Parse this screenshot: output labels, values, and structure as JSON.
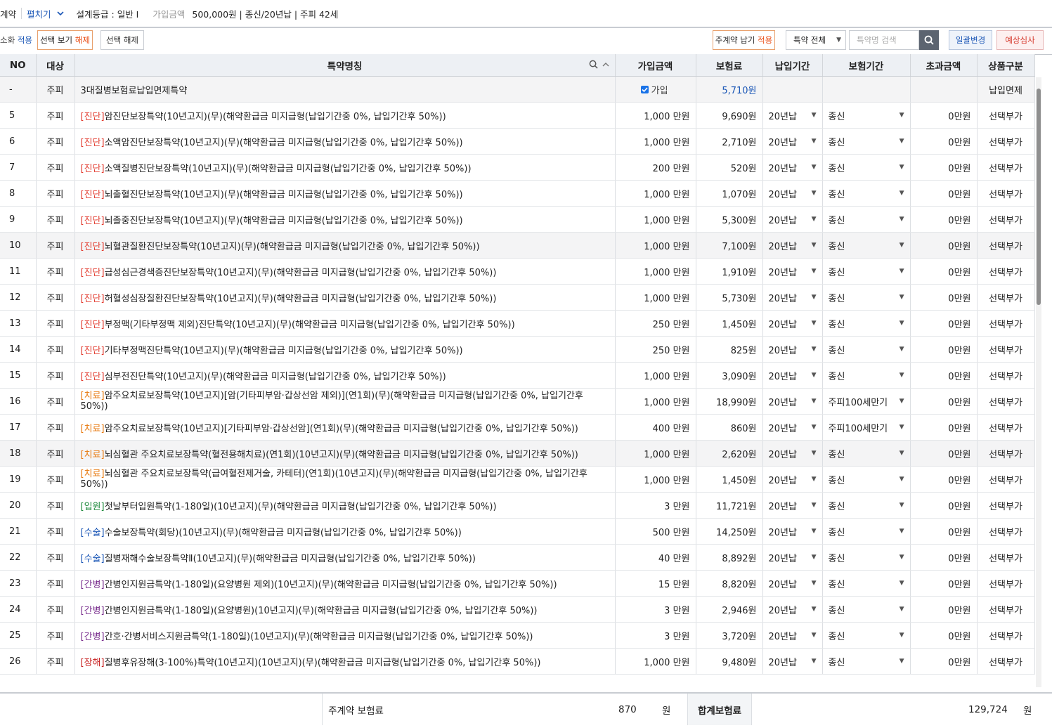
{
  "topbar": {
    "title_fragment": "계약",
    "expand_label": "펼치기",
    "grade": "설계등급 : 일반 I",
    "amount_label": "가입금액",
    "amount_value": "500,000원 | 종신/20년납 | 주피 42세"
  },
  "toolbar": {
    "apply_left_a": "소화",
    "apply_left_b": "적용",
    "view_selected_a": "선택 보기",
    "view_selected_b": "해제",
    "clear_selection": "선택 해제",
    "main_pay_a": "주계약 납기",
    "main_pay_b": "적용",
    "filter_value": "특약 전체",
    "search_placeholder": "특약명 검색",
    "bulk_change": "일괄변경",
    "review": "예상심사"
  },
  "columns": [
    "NO",
    "대상",
    "특약명칭",
    "가입금액",
    "보험료",
    "납입기간",
    "보험기간",
    "초과금액",
    "상품구분"
  ],
  "waiver_row": {
    "no": "-",
    "target": "주피",
    "name": "3대질병보험료납입면제특약",
    "checkbox_label": "가입",
    "premium": "5,710원",
    "kind": "납입면제"
  },
  "rows": [
    {
      "no": "5",
      "target": "주피",
      "tag": "[진단]",
      "tagcls": "진단",
      "name": "암진단보장특약(10년고지)(무)(해약환급금 미지급형(납입기간중 0%, 납입기간후 50%))",
      "amount": "1,000 만원",
      "premium": "9,690원",
      "pay": "20년납",
      "term": "종신",
      "excess": "0만원",
      "kind": "선택부가"
    },
    {
      "no": "6",
      "target": "주피",
      "tag": "[진단]",
      "tagcls": "진단",
      "name": "소액암진단보장특약(10년고지)(무)(해약환급금 미지급형(납입기간중 0%, 납입기간후 50%))",
      "amount": "1,000 만원",
      "premium": "2,710원",
      "pay": "20년납",
      "term": "종신",
      "excess": "0만원",
      "kind": "선택부가"
    },
    {
      "no": "7",
      "target": "주피",
      "tag": "[진단]",
      "tagcls": "진단",
      "name": "소액질병진단보장특약(10년고지)(무)(해약환급금 미지급형(납입기간중 0%, 납입기간후 50%))",
      "amount": "200 만원",
      "premium": "520원",
      "pay": "20년납",
      "term": "종신",
      "excess": "0만원",
      "kind": "선택부가"
    },
    {
      "no": "8",
      "target": "주피",
      "tag": "[진단]",
      "tagcls": "진단",
      "name": "뇌출혈진단보장특약(10년고지)(무)(해약환급금 미지급형(납입기간중 0%, 납입기간후 50%))",
      "amount": "1,000 만원",
      "premium": "1,070원",
      "pay": "20년납",
      "term": "종신",
      "excess": "0만원",
      "kind": "선택부가"
    },
    {
      "no": "9",
      "target": "주피",
      "tag": "[진단]",
      "tagcls": "진단",
      "name": "뇌졸중진단보장특약(10년고지)(무)(해약환급금 미지급형(납입기간중 0%, 납입기간후 50%))",
      "amount": "1,000 만원",
      "premium": "5,300원",
      "pay": "20년납",
      "term": "종신",
      "excess": "0만원",
      "kind": "선택부가"
    },
    {
      "no": "10",
      "target": "주피",
      "tag": "[진단]",
      "tagcls": "진단",
      "name": "뇌혈관질환진단보장특약(10년고지)(무)(해약환급금 미지급형(납입기간중 0%, 납입기간후 50%))",
      "amount": "1,000 만원",
      "premium": "7,100원",
      "pay": "20년납",
      "term": "종신",
      "excess": "0만원",
      "kind": "선택부가",
      "alt": true
    },
    {
      "no": "11",
      "target": "주피",
      "tag": "[진단]",
      "tagcls": "진단",
      "name": "급성심근경색증진단보장특약(10년고지)(무)(해약환급금 미지급형(납입기간중 0%, 납입기간후 50%))",
      "amount": "1,000 만원",
      "premium": "1,910원",
      "pay": "20년납",
      "term": "종신",
      "excess": "0만원",
      "kind": "선택부가"
    },
    {
      "no": "12",
      "target": "주피",
      "tag": "[진단]",
      "tagcls": "진단",
      "name": "허혈성심장질환진단보장특약(10년고지)(무)(해약환급금 미지급형(납입기간중 0%, 납입기간후 50%))",
      "amount": "1,000 만원",
      "premium": "5,730원",
      "pay": "20년납",
      "term": "종신",
      "excess": "0만원",
      "kind": "선택부가"
    },
    {
      "no": "13",
      "target": "주피",
      "tag": "[진단]",
      "tagcls": "진단",
      "name": "부정맥(기타부정맥 제외)진단특약(10년고지)(무)(해약환급금 미지급형(납입기간중 0%, 납입기간후 50%))",
      "amount": "250 만원",
      "premium": "1,450원",
      "pay": "20년납",
      "term": "종신",
      "excess": "0만원",
      "kind": "선택부가"
    },
    {
      "no": "14",
      "target": "주피",
      "tag": "[진단]",
      "tagcls": "진단",
      "name": "기타부정맥진단특약(10년고지)(무)(해약환급금 미지급형(납입기간중 0%, 납입기간후 50%))",
      "amount": "250 만원",
      "premium": "825원",
      "pay": "20년납",
      "term": "종신",
      "excess": "0만원",
      "kind": "선택부가"
    },
    {
      "no": "15",
      "target": "주피",
      "tag": "[진단]",
      "tagcls": "진단",
      "name": "심부전진단특약(10년고지)(무)(해약환급금 미지급형(납입기간중 0%, 납입기간후 50%))",
      "amount": "1,000 만원",
      "premium": "3,090원",
      "pay": "20년납",
      "term": "종신",
      "excess": "0만원",
      "kind": "선택부가"
    },
    {
      "no": "16",
      "target": "주피",
      "tag": "[치료]",
      "tagcls": "치료",
      "name": "암주요치료보장특약(10년고지)[암(기타피부암·갑상선암 제외)](연1회)(무)(해약환급금 미지급형(납입기간중 0%, 납입기간후 50%))",
      "amount": "1,000 만원",
      "premium": "18,990원",
      "pay": "20년납",
      "term": "주피100세만기",
      "excess": "0만원",
      "kind": "선택부가",
      "wrap": true
    },
    {
      "no": "17",
      "target": "주피",
      "tag": "[치료]",
      "tagcls": "치료",
      "name": "암주요치료보장특약(10년고지)[기타피부암·갑상선암](연1회)(무)(해약환급금 미지급형(납입기간중 0%, 납입기간후 50%))",
      "amount": "400 만원",
      "premium": "860원",
      "pay": "20년납",
      "term": "주피100세만기",
      "excess": "0만원",
      "kind": "선택부가"
    },
    {
      "no": "18",
      "target": "주피",
      "tag": "[치료]",
      "tagcls": "치료",
      "name": "뇌심혈관 주요치료보장특약(혈전용해치료)(연1회)(10년고지)(무)(해약환급금 미지급형(납입기간중 0%, 납입기간후 50%))",
      "amount": "1,000 만원",
      "premium": "2,620원",
      "pay": "20년납",
      "term": "종신",
      "excess": "0만원",
      "kind": "선택부가",
      "alt": true
    },
    {
      "no": "19",
      "target": "주피",
      "tag": "[치료]",
      "tagcls": "치료",
      "name": "뇌심혈관 주요치료보장특약(급여혈전제거술, 카테터)(연1회)(10년고지)(무)(해약환급금 미지급형(납입기간중 0%, 납입기간후 50%))",
      "amount": "1,000 만원",
      "premium": "1,450원",
      "pay": "20년납",
      "term": "종신",
      "excess": "0만원",
      "kind": "선택부가",
      "wrap": true
    },
    {
      "no": "20",
      "target": "주피",
      "tag": "[입원]",
      "tagcls": "입원",
      "name": "첫날부터입원특약(1-180일)(10년고지)(무)(해약환급금 미지급형(납입기간중 0%, 납입기간후 50%))",
      "amount": "3 만원",
      "premium": "11,721원",
      "pay": "20년납",
      "term": "종신",
      "excess": "0만원",
      "kind": "선택부가"
    },
    {
      "no": "21",
      "target": "주피",
      "tag": "[수술]",
      "tagcls": "수술",
      "name": "수술보장특약(회당)(10년고지)(무)(해약환급금 미지급형(납입기간중 0%, 납입기간후 50%))",
      "amount": "500 만원",
      "premium": "14,250원",
      "pay": "20년납",
      "term": "종신",
      "excess": "0만원",
      "kind": "선택부가"
    },
    {
      "no": "22",
      "target": "주피",
      "tag": "[수술]",
      "tagcls": "수술",
      "name": "질병재해수술보장특약Ⅱ(10년고지)(무)(해약환급금 미지급형(납입기간중 0%, 납입기간후 50%))",
      "amount": "40 만원",
      "premium": "8,892원",
      "pay": "20년납",
      "term": "종신",
      "excess": "0만원",
      "kind": "선택부가"
    },
    {
      "no": "23",
      "target": "주피",
      "tag": "[간병]",
      "tagcls": "간병",
      "name": "간병인지원금특약(1-180일)(요양병원 제외)(10년고지)(무)(해약환급금 미지급형(납입기간중 0%, 납입기간후 50%))",
      "amount": "15 만원",
      "premium": "8,820원",
      "pay": "20년납",
      "term": "종신",
      "excess": "0만원",
      "kind": "선택부가"
    },
    {
      "no": "24",
      "target": "주피",
      "tag": "[간병]",
      "tagcls": "간병",
      "name": "간병인지원금특약(1-180일)(요양병원)(10년고지)(무)(해약환급금 미지급형(납입기간중 0%, 납입기간후 50%))",
      "amount": "3 만원",
      "premium": "2,946원",
      "pay": "20년납",
      "term": "종신",
      "excess": "0만원",
      "kind": "선택부가"
    },
    {
      "no": "25",
      "target": "주피",
      "tag": "[간병]",
      "tagcls": "간병",
      "name": "간호·간병서비스지원금특약(1-180일)(10년고지)(무)(해약환급금 미지급형(납입기간중 0%, 납입기간후 50%))",
      "amount": "3 만원",
      "premium": "3,720원",
      "pay": "20년납",
      "term": "종신",
      "excess": "0만원",
      "kind": "선택부가"
    },
    {
      "no": "26",
      "target": "주피",
      "tag": "[장해]",
      "tagcls": "장해",
      "name": "질병후유장해(3-100%)특약(10년고지)(10년고지)(무)(해약환급금 미지급형(납입기간중 0%, 납입기간후 50%))",
      "amount": "1,000 만원",
      "premium": "9,480원",
      "pay": "20년납",
      "term": "종신",
      "excess": "0만원",
      "kind": "선택부가"
    }
  ],
  "footer": {
    "main_label": "주계약 보험료",
    "main_value": "870",
    "main_unit": "원",
    "total_label": "합계보험료",
    "total_value": "129,724",
    "total_unit": "원"
  }
}
